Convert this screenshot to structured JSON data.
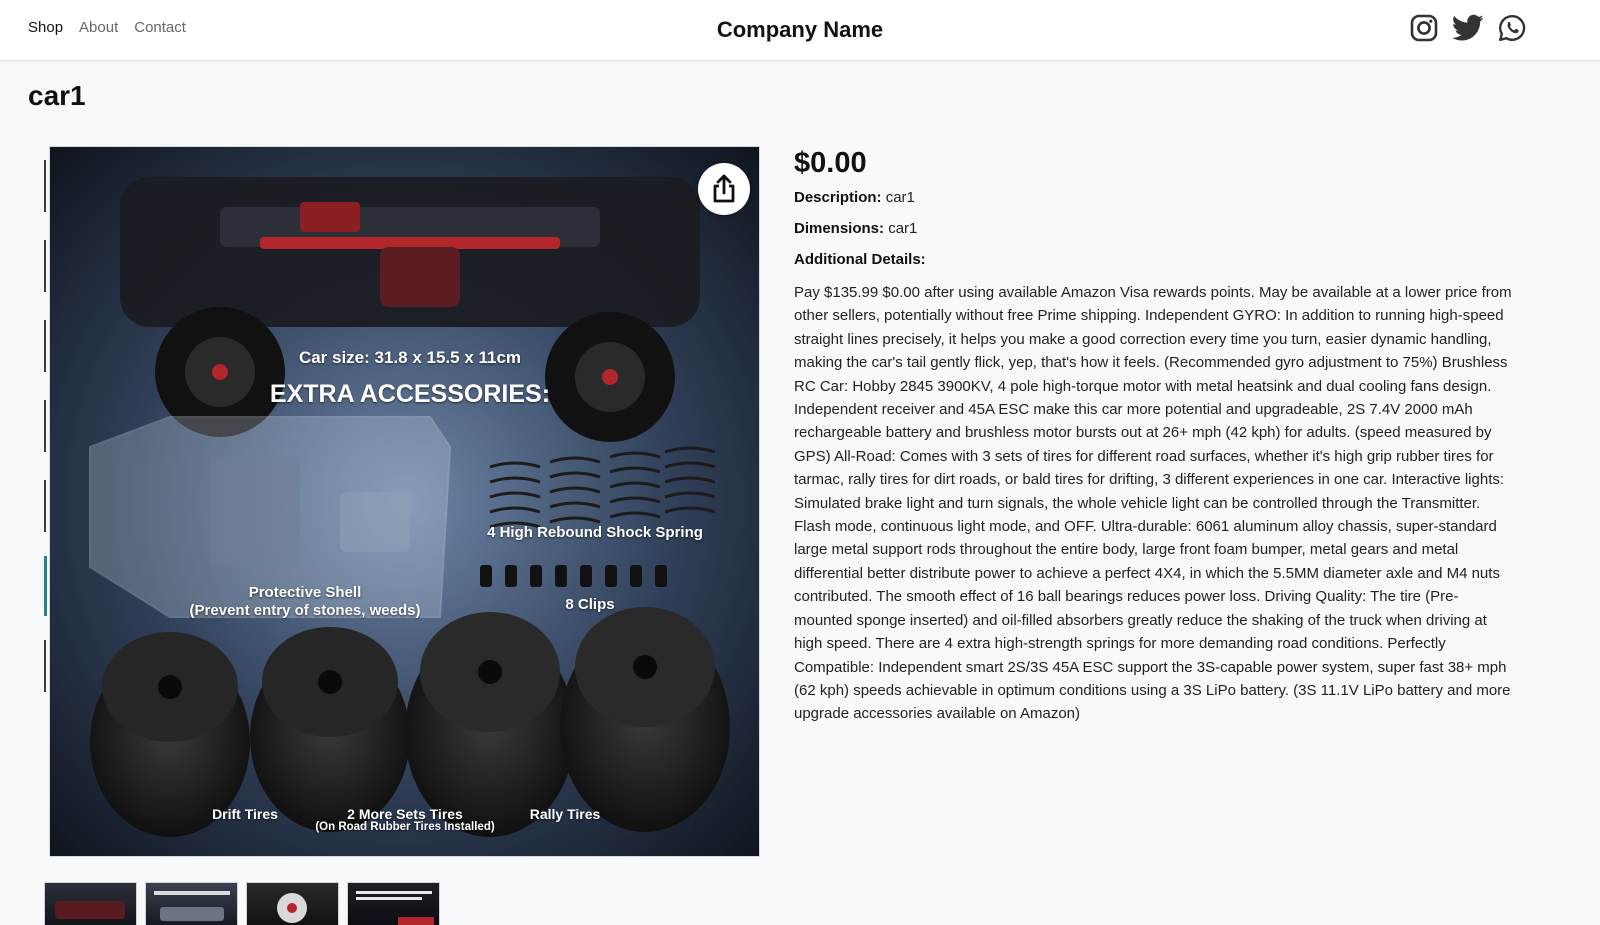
{
  "header": {
    "nav": [
      "Shop",
      "About",
      "Contact"
    ],
    "brand": "Company Name",
    "social_icons": [
      "instagram-icon",
      "twitter-icon",
      "whatsapp-icon"
    ]
  },
  "product": {
    "title": "car1",
    "price": "$0.00",
    "description_label": "Description:",
    "description_value": "car1",
    "dimensions_label": "Dimensions:",
    "dimensions_value": "car1",
    "additional_label": "Additional Details:",
    "additional_text": "Pay $135.99 $0.00 after using available Amazon Visa rewards points. May be available at a lower price from other sellers, potentially without free Prime shipping. Independent GYRO: In addition to running high-speed straight lines precisely, it helps you make a good correction every time you turn, easier dynamic handling, making the car's tail gently flick, yep, that's how it feels. (Recommended gyro adjustment to 75%) Brushless RC Car: Hobby 2845 3900KV, 4 pole high-torque motor with metal heatsink and dual cooling fans design. Independent receiver and 45A ESC make this car more potential and upgradeable, 2S 7.4V 2000 mAh rechargeable battery and brushless motor bursts out at 26+ mph (42 kph) for adults. (speed measured by GPS) All-Road: Comes with 3 sets of tires for different road surfaces, whether it's high grip rubber tires for tarmac, rally tires for dirt roads, or bald tires for drifting, 3 different experiences in one car. Interactive lights: Simulated brake light and turn signals, the whole vehicle light can be controlled through the Transmitter. Flash mode, continuous light mode, and OFF. Ultra-durable: 6061 aluminum alloy chassis, super-standard large metal support rods throughout the entire body, large front foam bumper, metal gears and metal differential better distribute power to achieve a perfect 4X4, in which the 5.5MM diameter axle and M4 nuts contributed. The smooth effect of 16 ball bearings reduces power loss. Driving Quality: The tire (Pre-mounted sponge inserted) and oil-filled absorbers greatly reduce the shaking of the truck when driving at high speed. There are 4 extra high-strength springs for more demanding road conditions. Perfectly Compatible: Independent smart 2S/3S 45A ESC support the 3S-capable power system, super fast 38+ mph (62 kph) speeds achievable in optimum conditions using a 3S LiPo battery. (3S 11.1V LiPo battery and more upgrade accessories available on Amazon)"
  },
  "image_overlay": {
    "car_size": "Car size: 31.8 x 15.5 x 11cm",
    "extra": "EXTRA ACCESSORIES:",
    "springs": "4 High Rebound Shock Spring",
    "shell_line1": "Protective Shell",
    "shell_line2": "(Prevent entry of stones, weeds)",
    "clips": "8 Clips",
    "drift": "Drift Tires",
    "more_sets_line1": "2 More Sets Tires",
    "more_sets_line2": "(On Road Rubber Tires Installed)",
    "rally": "Rally Tires"
  },
  "colors": {
    "header_bg": "#ffffff",
    "page_bg": "#f8f9fb",
    "text": "#111111"
  }
}
